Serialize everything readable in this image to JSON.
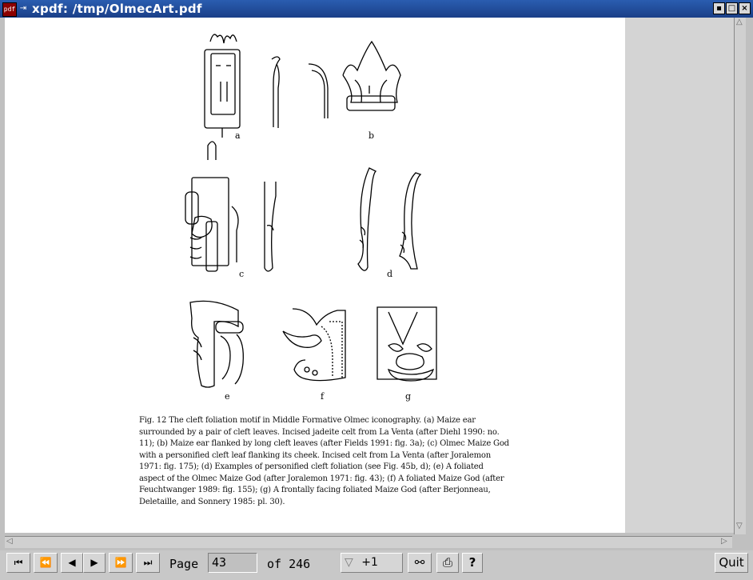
{
  "window": {
    "title": "xpdf: /tmp/OlmecArt.pdf",
    "app_icon_text": "pdf",
    "menu_icon_text": "⇥"
  },
  "figure": {
    "labels": [
      "a",
      "b",
      "c",
      "d",
      "e",
      "f",
      "g"
    ],
    "caption_lines": [
      "Fig. 12  The cleft foliation motif in Middle Formative Olmec iconography. (a) Maize ear",
      "surrounded by a pair of cleft leaves. Incised jadeite celt from La Venta (after Diehl 1990: no.",
      "11); (b) Maize ear flanked by long cleft leaves (after Fields 1991: fig. 3a); (c) Olmec Maize God",
      "with a personified cleft leaf flanking its cheek. Incised celt from La Venta (after Joralemon",
      "1971: fig. 175); (d) Examples of personified cleft foliation (see Fig. 45b, d); (e) A foliated",
      "aspect of the Olmec Maize God (after Joralemon 1971: fig. 43); (f) A foliated Maize God (after",
      "Feuchtwanger 1989: fig. 155); (g) A frontally facing foliated Maize God (after Berjonneau,",
      "Deletaille, and Sonnery 1985: pl. 30)."
    ]
  },
  "toolbar": {
    "first_page": "⏮",
    "prev_ten": "⏪",
    "prev_page": "◀",
    "next_page": "▶",
    "next_ten": "⏩",
    "last_page": "⏭",
    "page_label": "Page",
    "page_value": "43",
    "of_label": "of 246",
    "zoom_arrow": "▽",
    "zoom_value": "+1",
    "find_icon": "⚯",
    "print_icon": "⎙",
    "help_label": "?",
    "quit_label": "Quit"
  }
}
